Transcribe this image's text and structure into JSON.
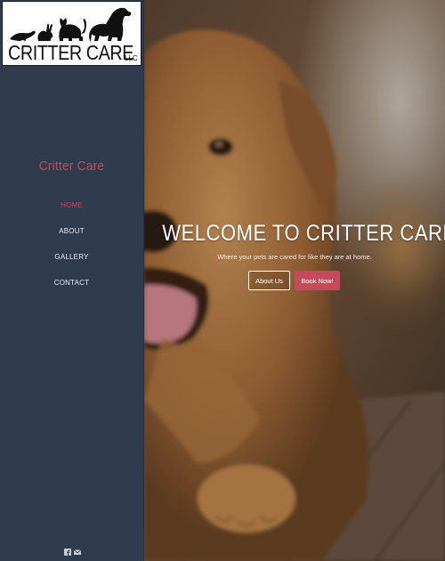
{
  "logo": {
    "text": "CRITTER CARE",
    "suffix": "LLC"
  },
  "sidebar": {
    "brand": "Critter Care",
    "nav": [
      {
        "label": "HOME",
        "active": true
      },
      {
        "label": "ABOUT",
        "active": false
      },
      {
        "label": "GALLERY",
        "active": false
      },
      {
        "label": "CONTACT",
        "active": false
      }
    ],
    "social": [
      "facebook-icon",
      "email-icon"
    ]
  },
  "hero": {
    "title": "WELCOME TO CRITTER CARE",
    "subtitle": "Where your pets are cared for like they are at home.",
    "buttons": {
      "about": "About Us",
      "book": "Book Now!"
    }
  },
  "colors": {
    "sidebar": "#2f3b4e",
    "accent": "#c44a5e",
    "button": "#c74a5c"
  }
}
